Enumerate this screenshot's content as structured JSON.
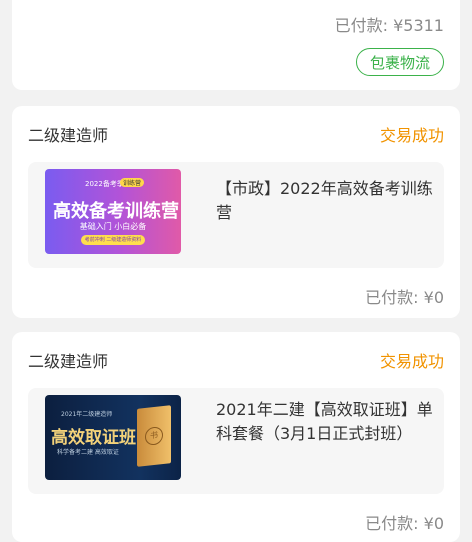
{
  "top_order": {
    "paid_label": "已付款: ¥5311",
    "logistics_button": "包裹物流"
  },
  "orders": [
    {
      "store": "二级建造师",
      "status": "交易成功",
      "title": "【市政】2022年高效备考训练营",
      "paid_label": "已付款: ¥0",
      "thumb": {
        "year": "2022备考季",
        "badge": "训练营",
        "main": "高效备考训练营",
        "sub": "基础入门 小白必备",
        "pill": "考前冲刺 二级建造师资料"
      }
    },
    {
      "store": "二级建造师",
      "status": "交易成功",
      "title": "2021年二建【高效取证班】单科套餐（3月1日正式封班）",
      "paid_label": "已付款: ¥0",
      "thumb": {
        "top": "2021年二级建造师",
        "main": "高效取证班",
        "sub": "科学备考二建 高效取证",
        "book": "书"
      }
    }
  ],
  "colors": {
    "status": "#f19300",
    "logistics": "#3bb24a",
    "background": "#f2f2f2"
  }
}
